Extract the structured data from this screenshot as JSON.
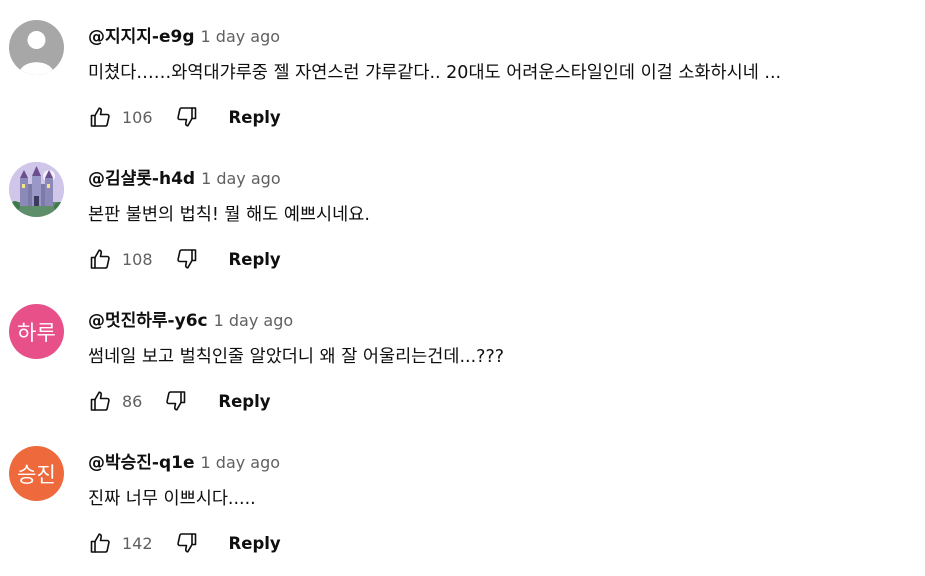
{
  "comments": [
    {
      "avatar": {
        "type": "silhouette-icon",
        "bg": "#a7a7a7"
      },
      "handle": "@지지지-e9g",
      "time": "1 day ago",
      "text": "미쳤다……와역대갸루중 젤 자연스런 갸루같다.. 20대도 어려운스타일인데 이걸 소화하시네 ...",
      "likes": "106",
      "reply_label": "Reply"
    },
    {
      "avatar": {
        "type": "castle-image",
        "bg": "#c9c2e6"
      },
      "handle": "@김샬롯-h4d",
      "time": "1 day ago",
      "text": "본판 불변의 법칙! 뭘 해도 예쁘시네요.",
      "likes": "108",
      "reply_label": "Reply"
    },
    {
      "avatar": {
        "type": "initials",
        "initials": "하루",
        "bg": "#e8508a"
      },
      "handle": "@멋진하루-y6c",
      "time": "1 day ago",
      "text": "썸네일 보고 벌칙인줄 알았더니 왜 잘 어울리는건데...???",
      "likes": "86",
      "reply_label": "Reply"
    },
    {
      "avatar": {
        "type": "initials",
        "initials": "승진",
        "bg": "#ee6a3d"
      },
      "handle": "@박승진-q1e",
      "time": "1 day ago",
      "text": "진짜 너무 이쁘시다.....",
      "likes": "142",
      "reply_label": "Reply"
    }
  ]
}
